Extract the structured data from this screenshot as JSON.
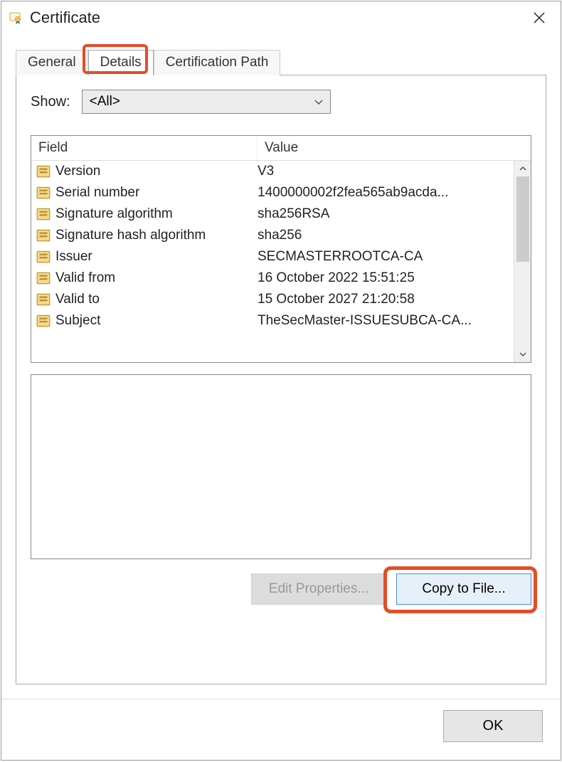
{
  "window": {
    "title": "Certificate"
  },
  "tabs": {
    "items": [
      {
        "label": "General"
      },
      {
        "label": "Details",
        "active": true
      },
      {
        "label": "Certification Path"
      }
    ]
  },
  "show": {
    "label": "Show:",
    "selected": "<All>"
  },
  "columns": {
    "field": "Field",
    "value": "Value"
  },
  "fields": [
    {
      "name": "Version",
      "value": "V3"
    },
    {
      "name": "Serial number",
      "value": "1400000002f2fea565ab9acda..."
    },
    {
      "name": "Signature algorithm",
      "value": "sha256RSA"
    },
    {
      "name": "Signature hash algorithm",
      "value": "sha256"
    },
    {
      "name": "Issuer",
      "value": "SECMASTERROOTCA-CA"
    },
    {
      "name": "Valid from",
      "value": "16 October 2022 15:51:25"
    },
    {
      "name": "Valid to",
      "value": "15 October 2027 21:20:58"
    },
    {
      "name": "Subject",
      "value": "TheSecMaster-ISSUESUBCA-CA..."
    }
  ],
  "buttons": {
    "edit": "Edit Properties...",
    "copy": "Copy to File...",
    "ok": "OK"
  }
}
